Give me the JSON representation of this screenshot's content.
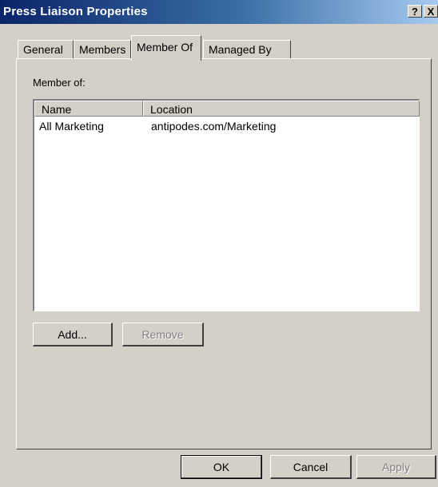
{
  "window": {
    "title": "Press Liaison Properties",
    "help_label": "?",
    "close_label": "X"
  },
  "tabs": [
    {
      "label": "General",
      "active": false
    },
    {
      "label": "Members",
      "active": false
    },
    {
      "label": "Member Of",
      "active": true
    },
    {
      "label": "Managed By",
      "active": false
    }
  ],
  "member_of": {
    "label": "Member of:",
    "columns": [
      "Name",
      "Location"
    ],
    "rows": [
      {
        "name": "All Marketing",
        "location": "antipodes.com/Marketing"
      }
    ],
    "add_label": "Add...",
    "remove_label": "Remove"
  },
  "footer": {
    "ok_label": "OK",
    "cancel_label": "Cancel",
    "apply_label": "Apply"
  },
  "colors": {
    "titlebar_start": "#0a246a",
    "titlebar_end": "#a6caf0",
    "face": "#d4d0c8"
  }
}
